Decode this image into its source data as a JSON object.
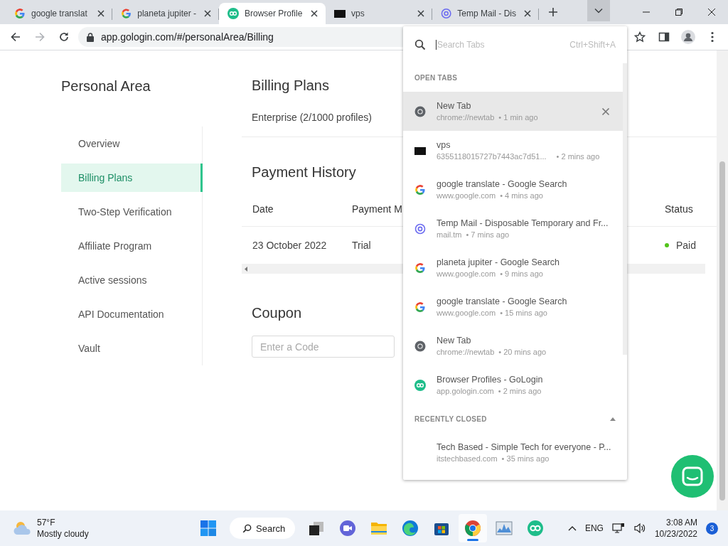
{
  "browser": {
    "tabs": [
      {
        "title": "google translat",
        "kind": "google",
        "selected": false
      },
      {
        "title": "planeta jupiter -",
        "kind": "google",
        "selected": false
      },
      {
        "title": "Browser Profile",
        "kind": "gologin",
        "selected": true
      },
      {
        "title": "vps",
        "kind": "terminal",
        "selected": false
      },
      {
        "title": "Temp Mail - Dis",
        "kind": "tempmail",
        "selected": false
      }
    ],
    "address": "app.gologin.com/#/personalArea/Billing"
  },
  "sidebar": {
    "title": "Personal Area",
    "items": [
      {
        "label": "Overview",
        "selected": false
      },
      {
        "label": "Billing Plans",
        "selected": true
      },
      {
        "label": "Two-Step Verification",
        "selected": false
      },
      {
        "label": "Affiliate Program",
        "selected": false
      },
      {
        "label": "Active sessions",
        "selected": false
      },
      {
        "label": "API Documentation",
        "selected": false
      },
      {
        "label": "Vault",
        "selected": false
      }
    ]
  },
  "billing": {
    "title": "Billing Plans",
    "plan": "Enterprise (2/1000 profiles)"
  },
  "payment_history": {
    "title": "Payment History",
    "columns": [
      "Date",
      "Payment M",
      "Status"
    ],
    "rows": [
      {
        "date": "23 October 2022",
        "method": "Trial",
        "status": "Paid"
      }
    ]
  },
  "coupon": {
    "title": "Coupon",
    "placeholder": "Enter a Code"
  },
  "tab_search": {
    "placeholder": "Search Tabs",
    "shortcut": "Ctrl+Shift+A",
    "open_heading": "OPEN TABS",
    "open_tabs": [
      {
        "title": "New Tab",
        "url": "chrome://newtab",
        "time": "• 1 min ago",
        "kind": "chrome",
        "selected": true
      },
      {
        "title": "vps",
        "url": "6355118015727b7443ac7d51...",
        "time": "• 2 mins ago",
        "kind": "terminal",
        "selected": false
      },
      {
        "title": "google translate - Google Search",
        "url": "www.google.com",
        "time": "• 4 mins ago",
        "kind": "google",
        "selected": false
      },
      {
        "title": "Temp Mail - Disposable Temporary and Fr...",
        "url": "mail.tm",
        "time": "• 7 mins ago",
        "kind": "tempmail",
        "selected": false
      },
      {
        "title": "planeta jupiter - Google Search",
        "url": "www.google.com",
        "time": "• 9 mins ago",
        "kind": "google",
        "selected": false
      },
      {
        "title": "google translate - Google Search",
        "url": "www.google.com",
        "time": "• 15 mins ago",
        "kind": "google",
        "selected": false
      },
      {
        "title": "New Tab",
        "url": "chrome://newtab",
        "time": "• 20 mins ago",
        "kind": "chrome",
        "selected": false
      },
      {
        "title": "Browser Profiles - GoLogin",
        "url": "app.gologin.com",
        "time": "• 2 mins ago",
        "kind": "gologin",
        "selected": false
      }
    ],
    "closed_heading": "RECENTLY CLOSED",
    "closed_expanded": true,
    "closed_tabs": [
      {
        "title": "Tech Based - Simple Tech for everyone - P...",
        "url": "itstechbased.com",
        "time": "• 35 mins ago",
        "selected": false
      }
    ]
  },
  "taskbar": {
    "temperature": "57°F",
    "weather": "Mostly cloudy",
    "search": "Search",
    "apps": [
      {
        "kind": "start",
        "active": false
      },
      {
        "kind": "taskview",
        "active": false
      },
      {
        "kind": "chat",
        "active": false
      },
      {
        "kind": "folder",
        "active": false
      },
      {
        "kind": "edge",
        "active": false
      },
      {
        "kind": "store",
        "active": false
      },
      {
        "kind": "chrome",
        "active": true
      },
      {
        "kind": "monitor",
        "active": false
      },
      {
        "kind": "gologin",
        "active": false
      }
    ],
    "language": "ENG",
    "time": "3:08 AM",
    "date": "10/23/2022",
    "notifications": "3"
  }
}
